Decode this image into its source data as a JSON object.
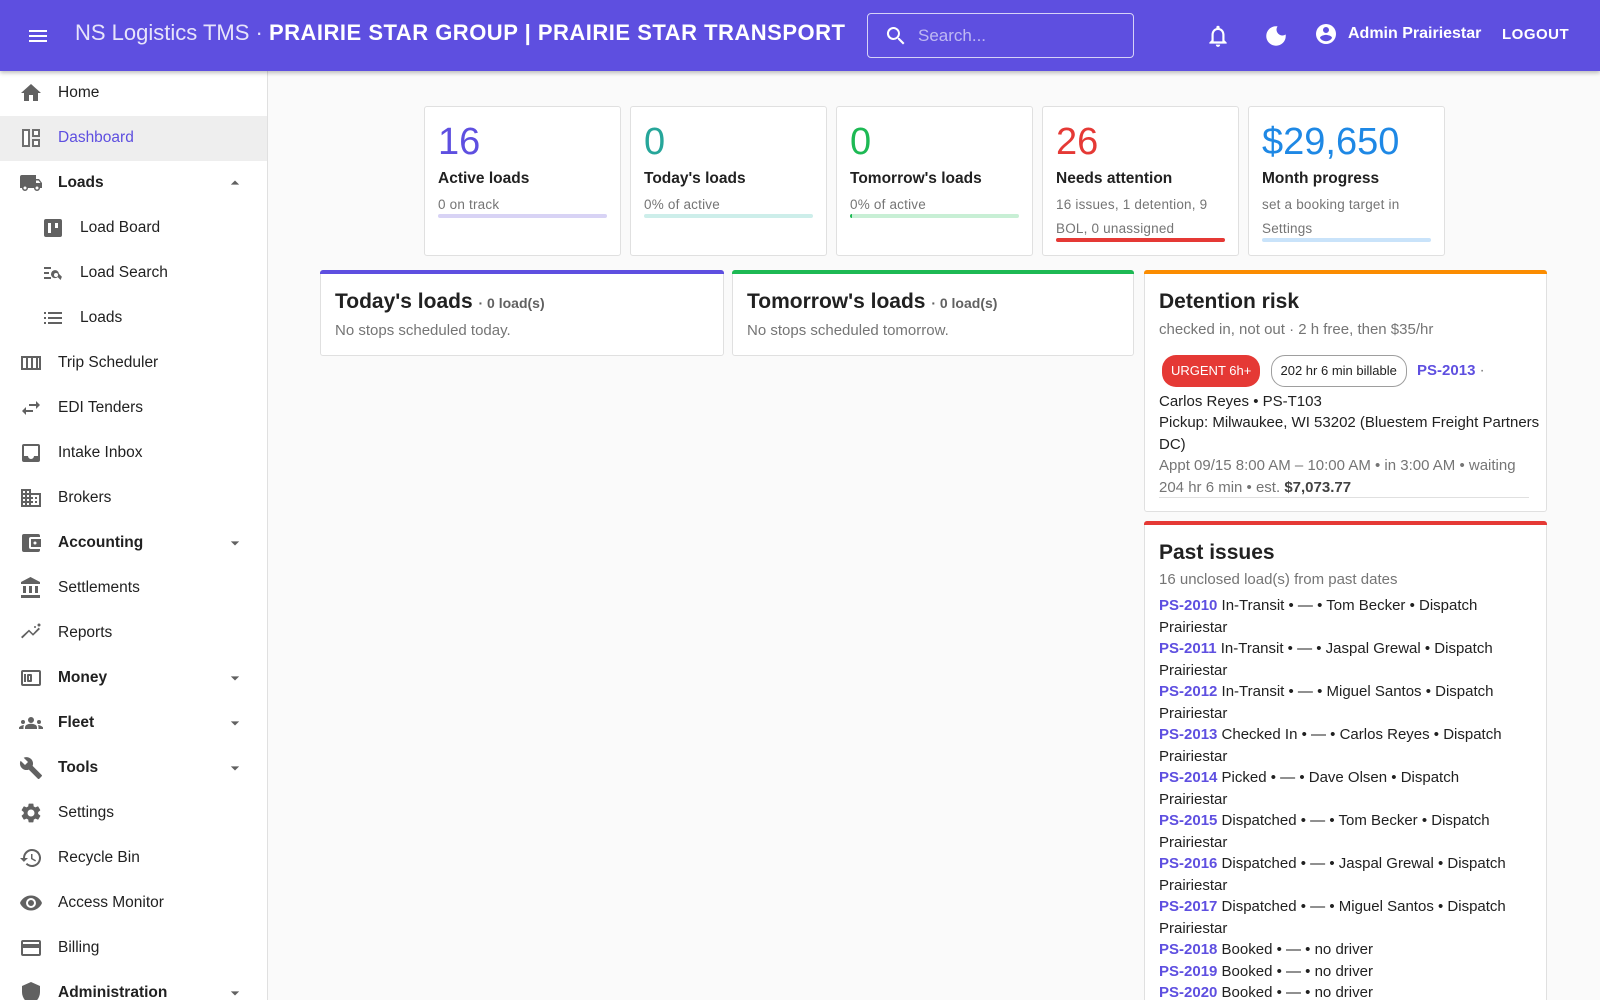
{
  "header": {
    "app_name": "NS Logistics TMS",
    "separator": " · ",
    "org_name": "PRAIRIE STAR GROUP | PRAIRIE STAR TRANSPORT",
    "search_placeholder": "Search...",
    "user_name": "Admin Prairiestar",
    "logout_label": "LOGOUT",
    "icons": [
      "menu-icon",
      "search-icon",
      "bell-icon",
      "dark-mode-icon",
      "account-icon"
    ]
  },
  "sidebar": {
    "items": [
      {
        "label": "Home",
        "icon": "home-icon"
      },
      {
        "label": "Dashboard",
        "icon": "dashboard-icon",
        "active": true
      },
      {
        "label": "Loads",
        "icon": "truck-icon",
        "expanded": true
      },
      {
        "label": "Load Board",
        "icon": "board-icon"
      },
      {
        "label": "Load Search",
        "icon": "list-search-icon"
      },
      {
        "label": "Loads",
        "icon": "list-icon"
      },
      {
        "label": "Trip Scheduler",
        "icon": "calendar-icon"
      },
      {
        "label": "EDI Tenders",
        "icon": "swap-icon"
      },
      {
        "label": "Intake Inbox",
        "icon": "inbox-icon"
      },
      {
        "label": "Brokers",
        "icon": "building-icon"
      },
      {
        "label": "Accounting",
        "icon": "wallet-icon"
      },
      {
        "label": "Settlements",
        "icon": "bank-icon"
      },
      {
        "label": "Reports",
        "icon": "chart-icon"
      },
      {
        "label": "Money",
        "icon": "money-icon"
      },
      {
        "label": "Fleet",
        "icon": "people-icon"
      },
      {
        "label": "Tools",
        "icon": "wrench-icon"
      },
      {
        "label": "Settings",
        "icon": "gear-icon"
      },
      {
        "label": "Recycle Bin",
        "icon": "history-icon"
      },
      {
        "label": "Access Monitor",
        "icon": "eye-icon"
      },
      {
        "label": "Billing",
        "icon": "credit-card-icon"
      },
      {
        "label": "Administration",
        "icon": "shield-icon"
      }
    ]
  },
  "stats": [
    {
      "value": "16",
      "title": "Active loads",
      "sub": "0 on track",
      "color": "#5e4fe0",
      "bar_color": "#d8d3f5",
      "fill_color": "#5e4fe0",
      "progress": 0
    },
    {
      "value": "0",
      "title": "Today's loads",
      "sub": "0% of active",
      "color": "#26a69a",
      "bar_color": "#cdeeea",
      "fill_color": "#26a69a",
      "progress": 0
    },
    {
      "value": "0",
      "title": "Tomorrow's loads",
      "sub": "0% of active",
      "color": "#1db954",
      "bar_color": "#c8efd5",
      "fill_color": "#1db954",
      "progress": 0.01
    },
    {
      "value": "26",
      "title": "Needs attention",
      "sub": "16 issues, 1 detention, 9 BOL, 0 unassigned",
      "color": "#e53935",
      "bar_color": "#f7c7c6",
      "fill_color": "#e53935",
      "progress": 1
    },
    {
      "value": "$29,650",
      "title": "Month progress",
      "sub": "set a booking target in Settings",
      "color": "#1e88e5",
      "bar_color": "#c9e3fa",
      "fill_color": "#1e88e5",
      "progress": 0
    }
  ],
  "today_panel": {
    "title": "Today's loads",
    "count": "· 0 load(s)",
    "desc": "No stops scheduled today.",
    "color": "#5e4fe0"
  },
  "tomorrow_panel": {
    "title": "Tomorrow's loads",
    "count": "· 0 load(s)",
    "desc": "No stops scheduled tomorrow.",
    "color": "#1db954"
  },
  "detention": {
    "title": "Detention risk",
    "desc": "checked in, not out · 2 h free, then $35/hr",
    "color": "#fb8c00",
    "urgent_chip": "URGENT 6h+",
    "billable_chip": "202 hr 6 min billable",
    "load_id": "PS-2013",
    "dot": " ·",
    "driver_line": "Carlos Reyes • PS-T103",
    "pickup_line": "Pickup: Milwaukee, WI 53202 (Bluestem Freight Partners DC)",
    "appt_line": "Appt 09/15 8:00 AM – 10:00 AM • in 3:00 AM • waiting 204 hr 6 min • est. ",
    "est_amount": "$7,073.77"
  },
  "past_issues": {
    "title": "Past issues",
    "desc": "16 unclosed load(s) from past dates",
    "color": "#e53935",
    "rows": [
      {
        "id": "PS-2010",
        "text": " In-Transit • — • Tom Becker • Dispatch Prairiestar"
      },
      {
        "id": "PS-2011",
        "text": " In-Transit • — • Jaspal Grewal • Dispatch Prairiestar"
      },
      {
        "id": "PS-2012",
        "text": " In-Transit • — • Miguel Santos • Dispatch Prairiestar"
      },
      {
        "id": "PS-2013",
        "text": " Checked In • — • Carlos Reyes • Dispatch Prairiestar"
      },
      {
        "id": "PS-2014",
        "text": " Picked • — • Dave Olsen • Dispatch Prairiestar"
      },
      {
        "id": "PS-2015",
        "text": " Dispatched • — • Tom Becker • Dispatch Prairiestar"
      },
      {
        "id": "PS-2016",
        "text": " Dispatched • — • Jaspal Grewal • Dispatch Prairiestar"
      },
      {
        "id": "PS-2017",
        "text": " Dispatched • — • Miguel Santos • Dispatch Prairiestar"
      },
      {
        "id": "PS-2018",
        "text": " Booked • — • no driver"
      },
      {
        "id": "PS-2019",
        "text": " Booked • — • no driver"
      },
      {
        "id": "PS-2020",
        "text": " Booked • — • no driver"
      }
    ]
  }
}
